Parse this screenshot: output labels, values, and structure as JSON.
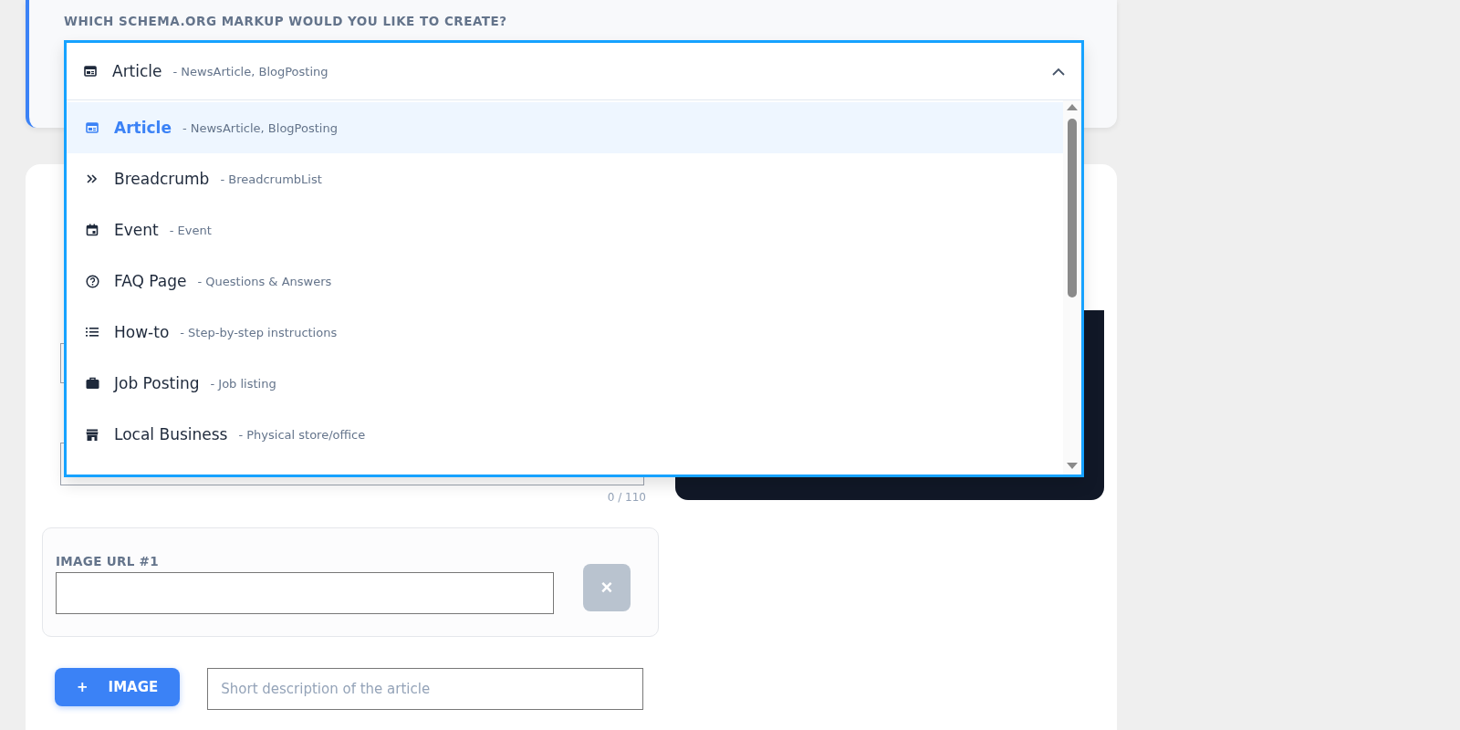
{
  "schema_picker": {
    "label": "WHICH SCHEMA.ORG MARKUP WOULD YOU LIKE TO CREATE?",
    "value": {
      "label": "Article",
      "description": "- NewsArticle, BlogPosting"
    },
    "expanded": true,
    "options": [
      {
        "label": "Article",
        "description": "- NewsArticle, BlogPosting",
        "selected": true
      },
      {
        "label": "Breadcrumb",
        "description": "- BreadcrumbList",
        "selected": false
      },
      {
        "label": "Event",
        "description": "- Event",
        "selected": false
      },
      {
        "label": "FAQ Page",
        "description": "- Questions & Answers",
        "selected": false
      },
      {
        "label": "How-to",
        "description": "- Step-by-step instructions",
        "selected": false
      },
      {
        "label": "Job Posting",
        "description": "- Job listing",
        "selected": false
      },
      {
        "label": "Local Business",
        "description": "- Physical store/office",
        "selected": false
      }
    ]
  },
  "form": {
    "counter": "0 / 110",
    "image_block": {
      "label": "IMAGE URL #1",
      "remove": "×"
    },
    "add_image": {
      "icon": "+",
      "label": "IMAGE"
    },
    "description": {
      "placeholder": "Short description of the article"
    }
  }
}
